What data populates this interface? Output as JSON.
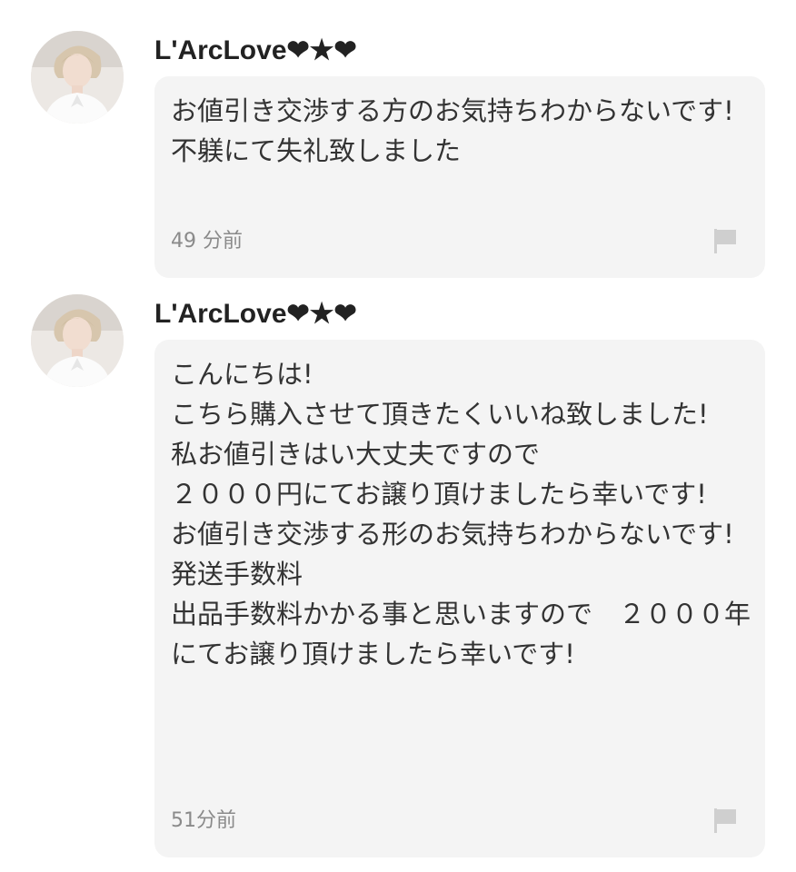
{
  "comments": [
    {
      "username": "L'ArcLove❤︎★❤︎",
      "message": "お値引き交渉する方のお気持ちわからないです!\n不躾にて失礼致しました",
      "time": "49 分前",
      "avatar_icon": "user-avatar-photo",
      "report_icon": "flag-icon"
    },
    {
      "username": "L'ArcLove❤︎★❤︎",
      "message": "こんにちは!\nこちら購入させて頂きたくいいね致しました!\n私お値引きはい大丈夫ですので\n２０００円にてお譲り頂けましたら幸いです!\nお値引き交渉する形のお気持ちわからないです!\n発送手数料\n出品手数料かかる事と思いますので　２０００年にてお譲り頂けましたら幸いです!",
      "time": "51分前",
      "avatar_icon": "user-avatar-photo",
      "report_icon": "flag-icon"
    }
  ],
  "colors": {
    "bubble_bg": "#f4f4f4",
    "text": "#333333",
    "timestamp": "#8a8a8a",
    "flag": "#cfcfcf"
  }
}
